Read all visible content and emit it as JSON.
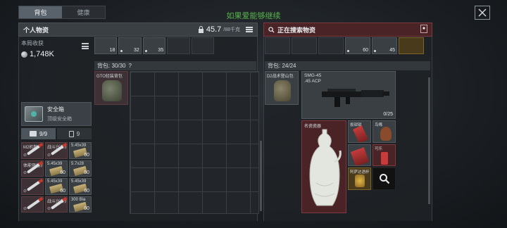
{
  "tabs": [
    {
      "label": "背包",
      "active": true
    },
    {
      "label": "健康",
      "active": false
    }
  ],
  "banner": "如果爱能够继续",
  "left_panel": {
    "title": "个人物资",
    "capacity": "45.7",
    "capacity_max": "/88千克"
  },
  "right_panel": {
    "title": "正在搜索物资"
  },
  "income": {
    "label": "本局收获",
    "value": "1,748K"
  },
  "safe_box": {
    "title": "安全箱",
    "subtitle": "顶级安全箱"
  },
  "slot_tabs": [
    {
      "label": "9/9"
    },
    {
      "label": "9"
    }
  ],
  "slots": [
    {
      "name": "M2机制",
      "count": ""
    },
    {
      "name": "战斗兴奋剂",
      "count": ""
    },
    {
      "name": "5.45x39",
      "count": "60"
    },
    {
      "name": "体能强化剂",
      "count": ""
    },
    {
      "name": "5.45x39",
      "count": "60"
    },
    {
      "name": "5.7x28",
      "count": "60"
    },
    {
      "name": "",
      "count": ""
    },
    {
      "name": "5.45x39",
      "count": "60"
    },
    {
      "name": "5.45x39",
      "count": "60"
    },
    {
      "name": "",
      "count": ""
    },
    {
      "name": "战斗兴奋剂",
      "count": ""
    },
    {
      "name": "300 Bla",
      "count": "60"
    }
  ],
  "left_top_items": [
    {
      "count": "18"
    },
    {
      "count": "32"
    },
    {
      "count": "35"
    }
  ],
  "left_backpack": {
    "label": "背包: 30/30",
    "help": "?",
    "item_name": "GTO轻装背包"
  },
  "right_top_items": [
    {
      "count": "60"
    },
    {
      "count": "45"
    }
  ],
  "right_backpack": {
    "label": "背包: 24/24",
    "item_name": "D2战术登山包"
  },
  "gun": {
    "name": "SMG-45",
    "ammo": ".45 ACP",
    "count": "0/25"
  },
  "vase": {
    "name": "名瓷瓷器"
  },
  "small_items": [
    {
      "name": "扳钳钳"
    },
    {
      "name": "鸟嘴"
    },
    {
      "name": ""
    },
    {
      "name": "可乐"
    },
    {
      "name": "阿萨达酒杯"
    },
    {
      "name": ""
    }
  ],
  "colors": {
    "accent_green": "#57b24a",
    "loot_red": "#4a2326"
  }
}
